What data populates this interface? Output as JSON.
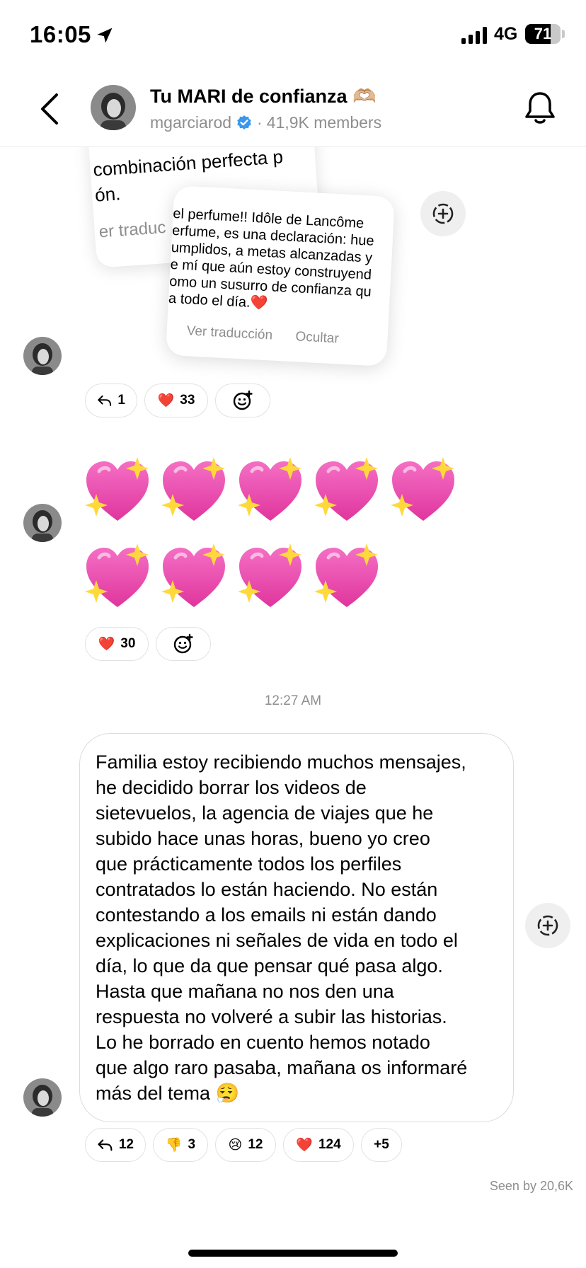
{
  "status": {
    "time": "16:05",
    "network": "4G",
    "battery": "71",
    "battery_level": 0.71
  },
  "header": {
    "title": "Tu MARI de confianza 🫶🏼",
    "username": "mgarciarod",
    "separator": "·",
    "members": "41,9K members"
  },
  "messages": {
    "shared_card_back": {
      "line1": "combinación perfecta p",
      "line2": "ón.",
      "line3": "er traduc"
    },
    "shared_card_front": {
      "lines": [
        "el perfume!! Idôle de Lancôme",
        "erfume, es una declaración: hue",
        "umplidos, a metas alcanzadas y",
        "e mí que aún estoy construyend",
        "omo un susurro de confianza qu",
        "a todo el día.❤️"
      ],
      "translate": "Ver traducción",
      "hide": "Ocultar"
    },
    "reactions_1": [
      {
        "icon": "reply-icon",
        "count": "1"
      },
      {
        "icon": "heart-emoji",
        "emoji": "❤️",
        "count": "33"
      },
      {
        "icon": "add-reaction-icon",
        "count": ""
      }
    ],
    "emoji_message": "💖💖💖💖💖💖💖💖💖",
    "reactions_2": [
      {
        "icon": "heart-emoji",
        "emoji": "❤️",
        "count": "30"
      },
      {
        "icon": "add-reaction-icon",
        "count": ""
      }
    ],
    "timestamp": "12:27 AM",
    "long_text": "Familia estoy recibiendo muchos mensajes,\nhe decidido borrar los videos de\nsietevuelos, la agencia de viajes que he\nsubido hace unas horas, bueno yo creo\nque prácticamente todos los perfiles\ncontratados lo están haciendo. No están\ncontestando a los emails ni están dando\nexplicaciones ni señales de vida en todo el\ndía, lo que da que pensar qué pasa algo.\nHasta que mañana no nos den una\nrespuesta no volveré a subir las historias.\nLo he borrado en cuento hemos notado\nque algo raro pasaba, mañana os informaré\nmás del tema 😮‍💨",
    "reactions_3": [
      {
        "icon": "reply-icon",
        "count": "12"
      },
      {
        "icon": "thumbs-down-emoji",
        "emoji": "👎",
        "count": "3"
      },
      {
        "icon": "crying-emoji",
        "emoji": "😢",
        "count": "12"
      },
      {
        "icon": "heart-emoji",
        "emoji": "❤️",
        "count": "124"
      },
      {
        "icon": "more-reactions",
        "count": "+5"
      }
    ],
    "seen": "Seen by 20,6K"
  },
  "colors": {
    "verified_blue": "#3897f0",
    "muted": "#8e8e8e",
    "heart_pink": "#e0359d"
  }
}
